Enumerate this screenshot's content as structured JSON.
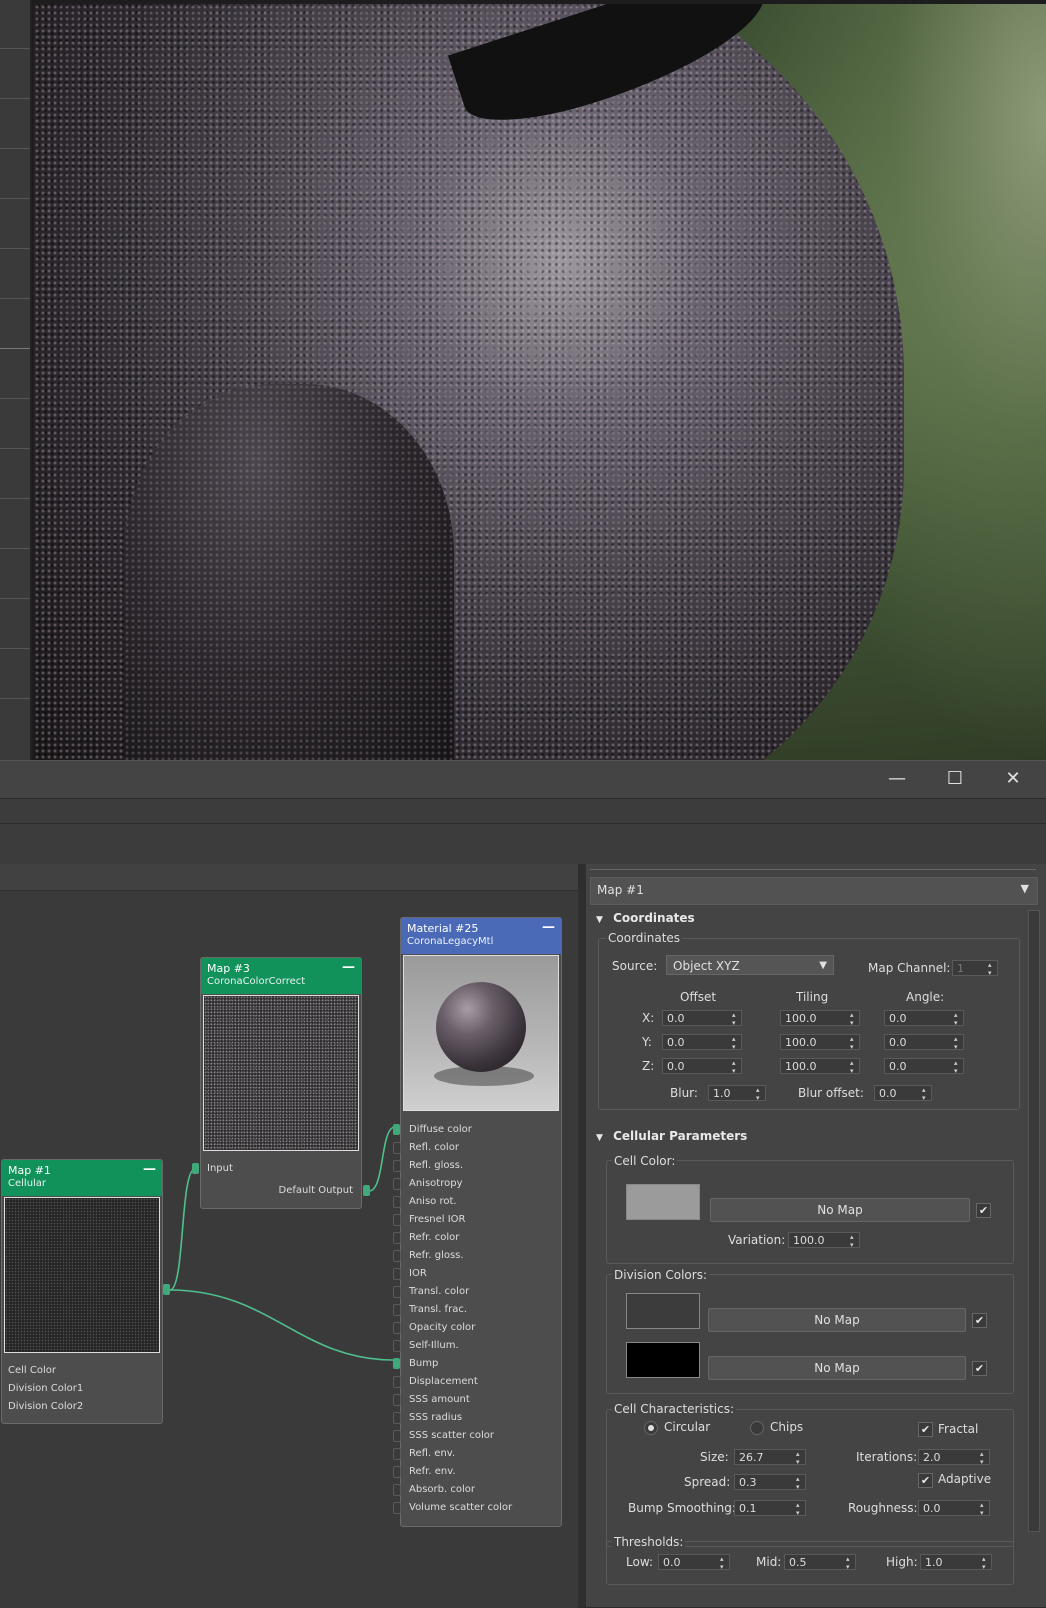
{
  "window": {
    "minimize": "—",
    "maximize": "☐",
    "close": "✕"
  },
  "nodes": {
    "map1": {
      "title": "Map #1",
      "subtitle": "Cellular",
      "minimize": "—",
      "outputs": [
        "Cell Color",
        "Division Color1",
        "Division Color2"
      ]
    },
    "map3": {
      "title": "Map #3",
      "subtitle": "CoronaColorCorrect",
      "minimize": "—",
      "input": "Input",
      "output": "Default Output"
    },
    "material": {
      "title": "Material #25",
      "subtitle": "CoronaLegacyMtl",
      "minimize": "—",
      "inputs": [
        "Diffuse color",
        "Refl. color",
        "Refl. gloss.",
        "Anisotropy",
        "Aniso rot.",
        "Fresnel IOR",
        "Refr. color",
        "Refr. gloss.",
        "IOR",
        "Transl. color",
        "Transl. frac.",
        "Opacity color",
        "Self-Illum.",
        "Bump",
        "Displacement",
        "SSS amount",
        "SSS radius",
        "SSS scatter color",
        "Refl. env.",
        "Refr. env.",
        "Absorb. color",
        "Volume scatter color"
      ]
    }
  },
  "panel": {
    "map_name": "Map #1",
    "coordinates": {
      "rollout_title": "Coordinates",
      "group_title": "Coordinates",
      "source_label": "Source:",
      "source_value": "Object XYZ",
      "map_channel_label": "Map Channel:",
      "map_channel_value": "1",
      "col_offset": "Offset",
      "col_tiling": "Tiling",
      "col_angle": "Angle:",
      "rows": [
        {
          "axis": "X:",
          "offset": "0.0",
          "tiling": "100.0",
          "angle": "0.0"
        },
        {
          "axis": "Y:",
          "offset": "0.0",
          "tiling": "100.0",
          "angle": "0.0"
        },
        {
          "axis": "Z:",
          "offset": "0.0",
          "tiling": "100.0",
          "angle": "0.0"
        }
      ],
      "blur_label": "Blur:",
      "blur_value": "1.0",
      "blur_offset_label": "Blur offset:",
      "blur_offset_value": "0.0"
    },
    "cellular": {
      "rollout_title": "Cellular Parameters",
      "cell_color_label": "Cell Color:",
      "cell_color": "#9b9b9b",
      "no_map": "No Map",
      "variation_label": "Variation:",
      "variation_value": "100.0",
      "division_colors_label": "Division Colors:",
      "division_color1": "#3c3c3c",
      "division_color2": "#000000",
      "characteristics_label": "Cell Characteristics:",
      "circular_label": "Circular",
      "chips_label": "Chips",
      "fractal_label": "Fractal",
      "size_label": "Size:",
      "size_value": "26.7",
      "iterations_label": "Iterations:",
      "iterations_value": "2.0",
      "spread_label": "Spread:",
      "spread_value": "0.3",
      "adaptive_label": "Adaptive",
      "bump_smoothing_label": "Bump Smoothing:",
      "bump_smoothing_value": "0.1",
      "roughness_label": "Roughness:",
      "roughness_value": "0.0",
      "thresholds_label": "Thresholds:",
      "low_label": "Low:",
      "low_value": "0.0",
      "mid_label": "Mid:",
      "mid_value": "0.5",
      "high_label": "High:",
      "high_value": "1.0",
      "check_mark": "✔"
    }
  },
  "colors": {
    "node_green": "#11925a",
    "node_blue": "#4a6ab8",
    "wire": "#4fc08d"
  }
}
